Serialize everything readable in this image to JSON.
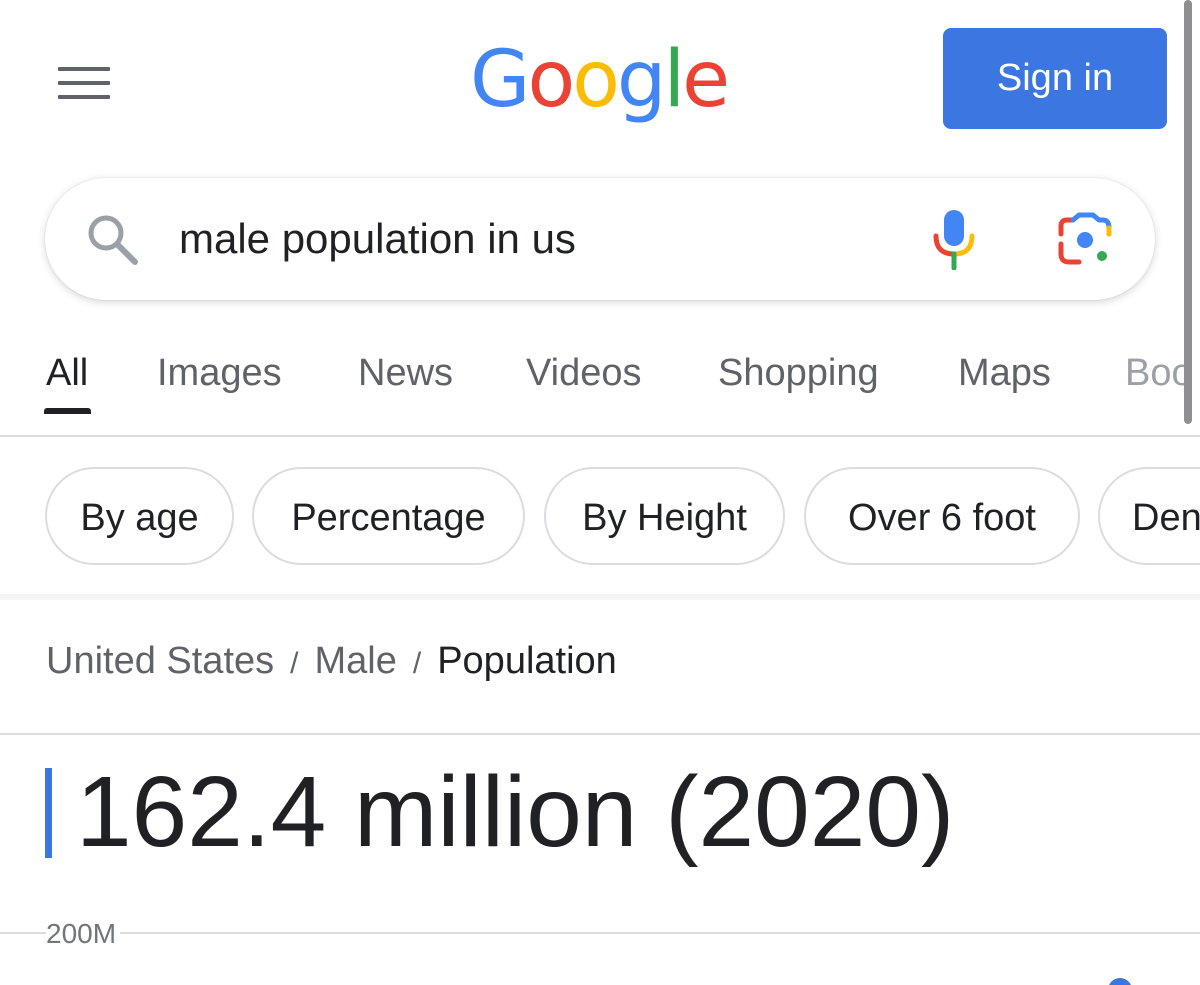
{
  "header": {
    "logo_text": "Google",
    "logo_colors": [
      "#4285F4",
      "#EA4335",
      "#FBBC05",
      "#4285F4",
      "#34A853",
      "#EA4335"
    ],
    "signin_label": "Sign in",
    "signin_color": "#3B76E1"
  },
  "search": {
    "query": "male population in us",
    "icons": [
      "search-icon",
      "microphone-icon",
      "google-lens-icon"
    ]
  },
  "tabs": [
    {
      "label": "All",
      "active": true
    },
    {
      "label": "Images"
    },
    {
      "label": "News"
    },
    {
      "label": "Videos"
    },
    {
      "label": "Shopping"
    },
    {
      "label": "Maps"
    },
    {
      "label": "Boo"
    }
  ],
  "chips": [
    "By age",
    "Percentage",
    "By Height",
    "Over 6 foot",
    "Den"
  ],
  "breadcrumb": [
    "United States",
    "Male",
    "Population"
  ],
  "answer": {
    "value": "162.4 million (2020)",
    "accent_color": "#3B76E1"
  },
  "chart": {
    "tick_label": "200M"
  }
}
